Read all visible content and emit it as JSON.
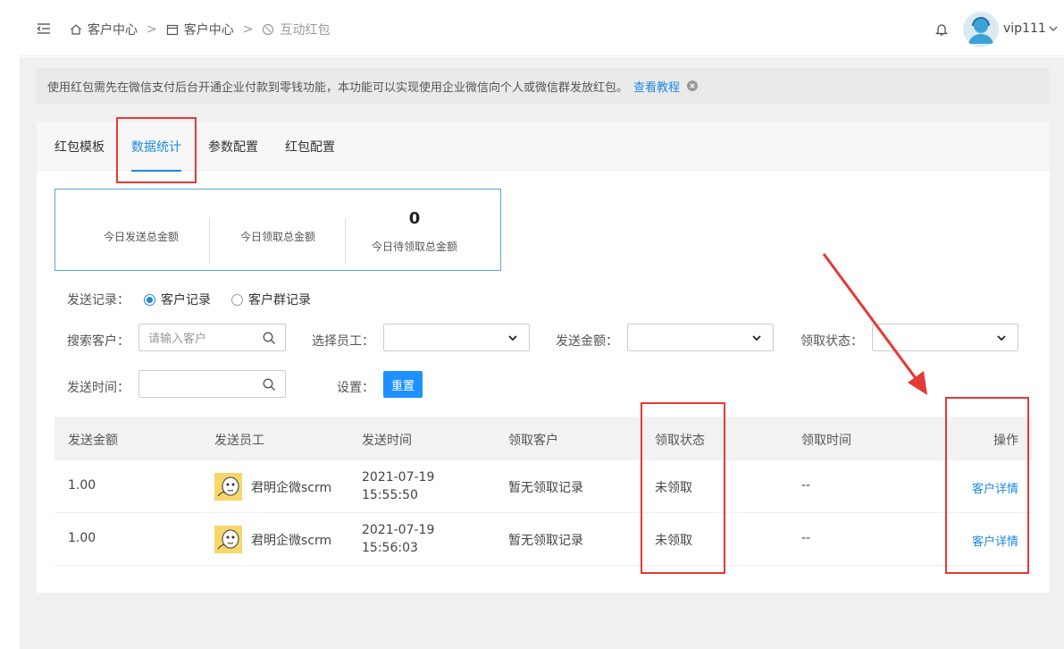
{
  "header": {
    "breadcrumb": [
      "客户中心",
      "客户中心",
      "互动红包"
    ],
    "separator": ">",
    "username": "vip111"
  },
  "notice": {
    "text": "使用红包需先在微信支付后台开通企业付款到零钱功能，本功能可以实现使用企业微信向个人或微信群发放红包。",
    "link": "查看教程"
  },
  "tabs": [
    "红包模板",
    "数据统计",
    "参数配置",
    "红包配置"
  ],
  "active_tab": 1,
  "stats": [
    {
      "label": "今日发送总金额",
      "value": ""
    },
    {
      "label": "今日领取总金额",
      "value": ""
    },
    {
      "label": "今日待领取总金额",
      "value": "0"
    }
  ],
  "filters": {
    "send_record_label": "发送记录：",
    "radio_customer": "客户记录",
    "radio_group": "客户群记录",
    "search_label": "搜索客户：",
    "search_placeholder": "请输入客户",
    "employee_label": "选择员工：",
    "amount_label": "发送金额：",
    "status_label": "领取状态：",
    "time_label": "发送时间：",
    "settings_label": "设置：",
    "reset": "重置"
  },
  "table": {
    "headers": [
      "发送金额",
      "发送员工",
      "发送时间",
      "领取客户",
      "领取状态",
      "领取时间",
      "操作"
    ],
    "rows": [
      {
        "amount": "1.00",
        "employee": "君明企微scrm",
        "date": "2021-07-19",
        "time": "15:55:50",
        "customer": "暂无领取记录",
        "status": "未领取",
        "recv_time": "--",
        "action": "客户详情"
      },
      {
        "amount": "1.00",
        "employee": "君明企微scrm",
        "date": "2021-07-19",
        "time": "15:56:03",
        "customer": "暂无领取记录",
        "status": "未领取",
        "recv_time": "--",
        "action": "客户详情"
      }
    ]
  },
  "colors": {
    "accent": "#1e88e5",
    "annotation": "#e53935"
  }
}
